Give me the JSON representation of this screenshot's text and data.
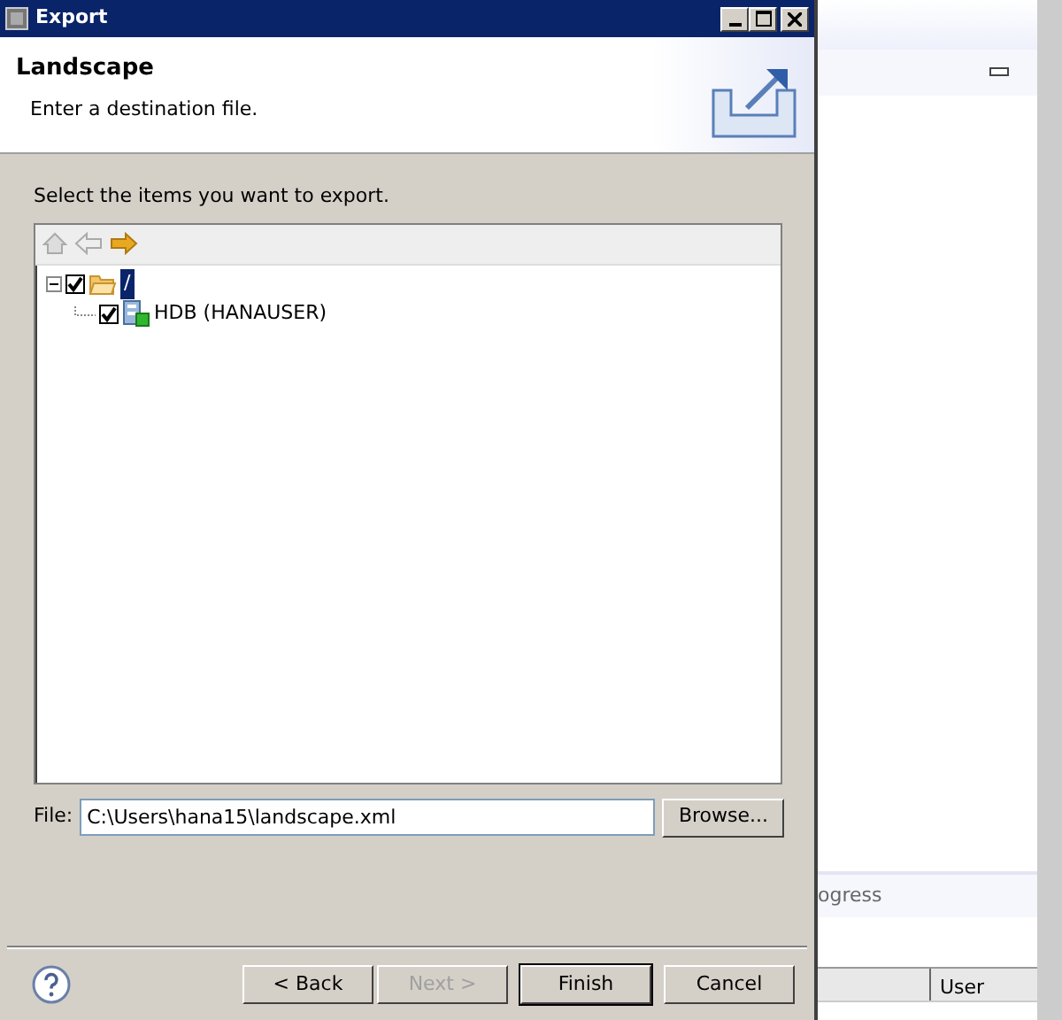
{
  "dialog": {
    "title": "Export",
    "heading": "Landscape",
    "description": "Enter a destination file.",
    "instruction": "Select the items you want to export.",
    "toolbar": [
      {
        "kind": "home",
        "disabled": true
      },
      {
        "kind": "back",
        "disabled": true
      },
      {
        "kind": "forward",
        "disabled": false
      }
    ],
    "tree": [
      {
        "label": "/",
        "kind": "folder",
        "checked": true,
        "expanded": true,
        "selected": true,
        "children": [
          {
            "label": "HDB (HANAUSER)",
            "kind": "system",
            "checked": true,
            "selected": false
          }
        ]
      }
    ],
    "file": {
      "label": "File:",
      "value": "C:\\Users\\hana15\\landscape.xml"
    },
    "browse": "Browse...",
    "buttons": [
      {
        "label": "< Back",
        "disabled": false,
        "default": false
      },
      {
        "label": "Next >",
        "disabled": true,
        "default": false
      },
      {
        "label": "Finish",
        "disabled": false,
        "default": true
      },
      {
        "label": "Cancel",
        "disabled": false,
        "default": false
      }
    ]
  },
  "background": {
    "status_text": "ogress",
    "column": "User"
  }
}
